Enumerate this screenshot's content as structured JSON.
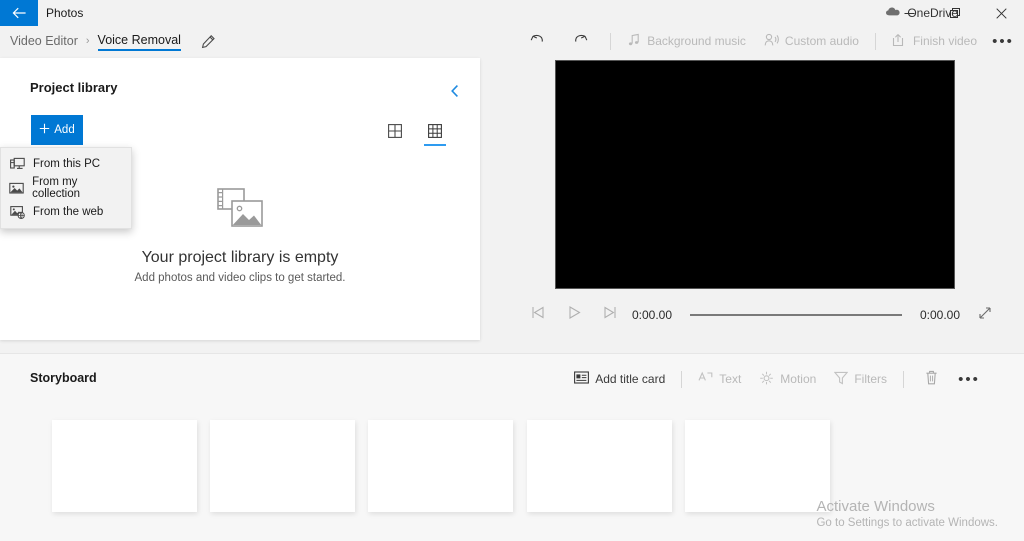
{
  "titlebar": {
    "back_icon": "back-arrow-icon",
    "app_title": "Photos",
    "onedrive_label": "OneDrive",
    "onedrive_icon": "cloud-icon",
    "minimize_label": "—",
    "maximize_label": "❐",
    "close_label": "✕",
    "accent_color": "#0078d4"
  },
  "breadcrumb": {
    "parent": "Video Editor",
    "separator": "›",
    "current": "Voice Removal",
    "edit_icon": "pencil-icon"
  },
  "top_toolbar": {
    "undo_icon": "undo-icon",
    "redo_icon": "redo-icon",
    "items": [
      {
        "label": "Background music",
        "icon": "music-note-icon",
        "enabled": false
      },
      {
        "label": "Custom audio",
        "icon": "person-audio-icon",
        "enabled": false
      },
      {
        "label": "Finish video",
        "icon": "export-icon",
        "enabled": false
      }
    ],
    "overflow_label": "•••"
  },
  "library": {
    "title": "Project library",
    "collapse_icon": "chevron-left-icon",
    "add_button": {
      "label": "Add",
      "icon": "plus-icon"
    },
    "view_toggles": [
      {
        "name": "large-grid-view",
        "active": false
      },
      {
        "name": "small-grid-view",
        "active": true
      }
    ],
    "empty_icon": "media-placeholder-icon",
    "empty_title": "Your project library is empty",
    "empty_subtitle": "Add photos and video clips to get started."
  },
  "add_menu": {
    "items": [
      {
        "label": "From this PC",
        "icon": "pc-icon"
      },
      {
        "label": "From my collection",
        "icon": "photo-icon"
      },
      {
        "label": "From the web",
        "icon": "photo-web-icon"
      }
    ]
  },
  "player": {
    "prev_frame_icon": "previous-frame-icon",
    "play_icon": "play-icon",
    "next_frame_icon": "next-frame-icon",
    "current_time": "0:00.00",
    "total_time": "0:00.00",
    "fullscreen_icon": "fullscreen-icon",
    "progress_percent": 0
  },
  "storyboard": {
    "title": "Storyboard",
    "toolbar": [
      {
        "label": "Add title card",
        "icon": "title-card-icon",
        "enabled": true
      },
      {
        "label": "Text",
        "icon": "text-icon",
        "enabled": false
      },
      {
        "label": "Motion",
        "icon": "motion-icon",
        "enabled": false
      },
      {
        "label": "Filters",
        "icon": "filters-icon",
        "enabled": false
      }
    ],
    "delete_icon": "trash-icon",
    "overflow_label": "•••",
    "card_count": 5
  },
  "watermark": {
    "title": "Activate Windows",
    "subtitle": "Go to Settings to activate Windows."
  }
}
